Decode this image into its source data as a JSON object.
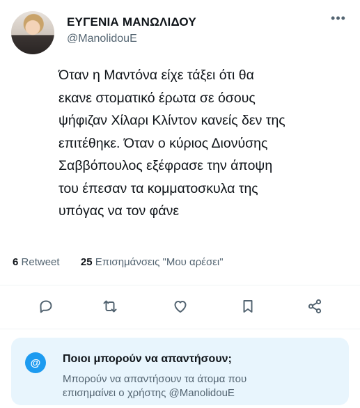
{
  "author": {
    "display_name": "ΕΥΓΕΝΙΑ ΜΑΝΩΛΙΔΟΥ",
    "handle": "@ManolidouE"
  },
  "more_label": "•••",
  "tweet": {
    "text": "Όταν η Μαντόνα είχε τάξει ότι θα\nεκανε στοματικό έρωτα σε όσους\nψήφιζαν Χίλαρι Κλίντον κανείς δεν της\nεπιτέθηκε. Όταν ο κύριος Διονύσης\nΣαββόπουλος εξέφρασε την άποψη\nτου έπεσαν τα κομματοσκυλα της\nυπόγας να τον φάνε"
  },
  "stats": {
    "retweets_count": "6",
    "retweets_label": "Retweet",
    "likes_count": "25",
    "likes_label": "Επισημάνσεις \"Μου αρέσει\""
  },
  "actions": [
    "reply-icon",
    "retweet-icon",
    "like-icon",
    "bookmark-icon",
    "share-icon"
  ],
  "reply_restriction": {
    "icon": "@",
    "title": "Ποιοι μπορούν να απαντήσουν;",
    "description": "Μπορούν να απαντήσουν τα άτομα που\nεπισημαίνει ο χρήστης @ManolidouE"
  },
  "colors": {
    "accent": "#1d9bf0",
    "secondary_text": "#536471",
    "reply_box_bg": "#e8f5fd"
  }
}
